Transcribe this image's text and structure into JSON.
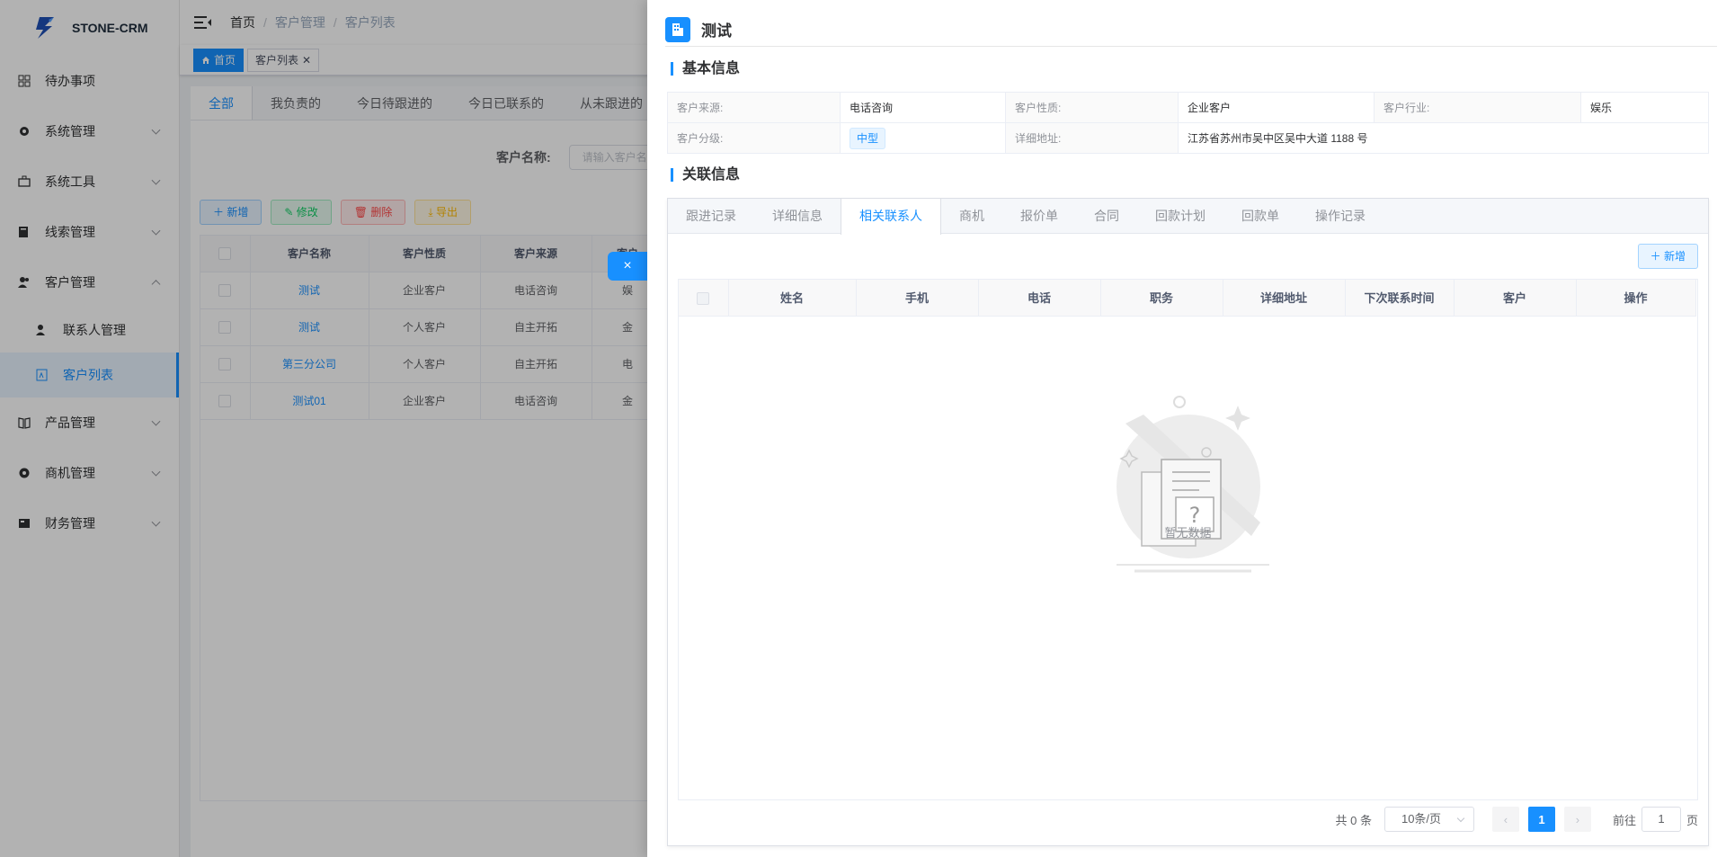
{
  "app": {
    "name": "STONE-CRM"
  },
  "sidebar": {
    "items": [
      {
        "label": "待办事项",
        "icon": "grid-icon",
        "has_arrow": false
      },
      {
        "label": "系统管理",
        "icon": "settings-icon",
        "has_arrow": true
      },
      {
        "label": "系统工具",
        "icon": "tools-icon",
        "has_arrow": true
      },
      {
        "label": "线索管理",
        "icon": "clue-icon",
        "has_arrow": true
      },
      {
        "label": "客户管理",
        "icon": "customer-icon",
        "has_arrow": true,
        "expanded": true
      }
    ],
    "sub_items": [
      {
        "label": "联系人管理",
        "icon": "contacts-icon"
      },
      {
        "label": "客户列表",
        "icon": "list-icon",
        "active": true
      }
    ],
    "items_after": [
      {
        "label": "产品管理",
        "icon": "book-icon"
      },
      {
        "label": "商机管理",
        "icon": "opportunity-icon"
      },
      {
        "label": "财务管理",
        "icon": "finance-icon"
      }
    ]
  },
  "breadcrumb": [
    "首页",
    "客户管理",
    "客户列表"
  ],
  "tags": [
    {
      "label": "首页",
      "active": true
    },
    {
      "label": "客户列表",
      "active": false
    }
  ],
  "list_page": {
    "tabs": [
      "全部",
      "我负责的",
      "今日待跟进的",
      "今日已联系的",
      "从未跟进的"
    ],
    "search_label": "客户名称:",
    "search_placeholder": "请输入客户名称",
    "buttons": {
      "add": "新增",
      "edit": "修改",
      "delete": "删除",
      "export": "导出"
    },
    "columns": [
      "客户名称",
      "客户性质",
      "客户来源",
      "客户"
    ],
    "rows": [
      [
        "测试",
        "企业客户",
        "电话咨询",
        "娱"
      ],
      [
        "测试",
        "个人客户",
        "自主开拓",
        "金"
      ],
      [
        "第三分公司",
        "个人客户",
        "自主开拓",
        "电"
      ],
      [
        "测试01",
        "企业客户",
        "电话咨询",
        "金"
      ]
    ]
  },
  "drawer": {
    "title": "测试",
    "close_symbol": "×",
    "basic_title": "基本信息",
    "basic": {
      "source_label": "客户来源:",
      "source": "电话咨询",
      "nature_label": "客户性质:",
      "nature": "企业客户",
      "industry_label": "客户行业:",
      "industry": "娱乐",
      "level_label": "客户分级:",
      "level": "中型",
      "address_label": "详细地址:",
      "address": "江苏省苏州市吴中区吴中大道 1188 号"
    },
    "related_title": "关联信息",
    "tabs": [
      "跟进记录",
      "详细信息",
      "相关联系人",
      "商机",
      "报价单",
      "合同",
      "回款计划",
      "回款单",
      "操作记录"
    ],
    "active_tab": "相关联系人",
    "add_label": "新增",
    "columns": [
      "姓名",
      "手机",
      "电话",
      "职务",
      "详细地址",
      "下次联系时间",
      "客户",
      "操作"
    ],
    "empty_text": "暂无数据",
    "pager": {
      "total": "共 0 条",
      "size": "10条/页",
      "current": "1",
      "goto_label": "前往",
      "goto_value": "1",
      "page_unit": "页"
    }
  },
  "colors": {
    "primary": "#1890ff",
    "sidebar_bg": "#ffffff",
    "overlay": "rgba(0,0,0,0.3)"
  }
}
